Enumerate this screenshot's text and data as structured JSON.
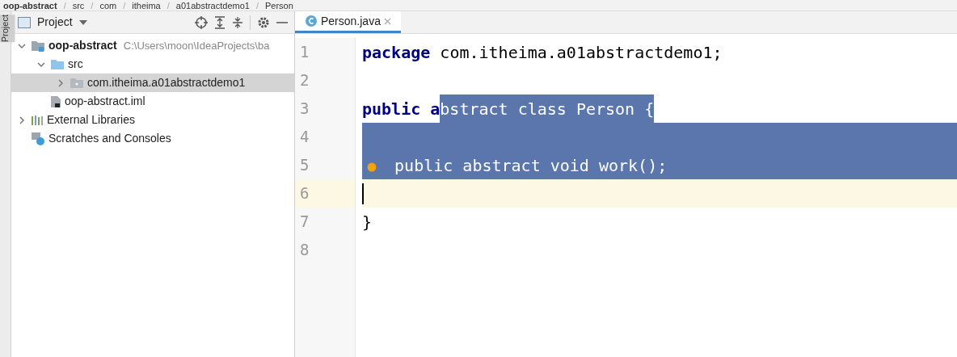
{
  "breadcrumb": [
    {
      "text": "oop-abstract",
      "kind": "item"
    },
    {
      "text": "/",
      "kind": "separator"
    },
    {
      "text": "src",
      "kind": "item"
    },
    {
      "text": "/",
      "kind": "separator"
    },
    {
      "text": "com",
      "kind": "item"
    },
    {
      "text": "/",
      "kind": "separator"
    },
    {
      "text": "itheima",
      "kind": "item"
    },
    {
      "text": "/",
      "kind": "separator"
    },
    {
      "text": "a01abstractdemo1",
      "kind": "item"
    },
    {
      "text": "/",
      "kind": "separator"
    },
    {
      "text": "Person",
      "kind": "item"
    }
  ],
  "tool_strip": {
    "label": "Project"
  },
  "project_panel": {
    "title": "Project",
    "tree": [
      {
        "label": "oop-abstract",
        "kind": "module",
        "path": "C:\\Users\\moon\\IdeaProjects\\ba",
        "expanded": true,
        "selected": false,
        "children": [
          {
            "label": "src",
            "kind": "folder",
            "expanded": true,
            "selected": false,
            "children": [
              {
                "label": "com.itheima.a01abstractdemo1",
                "kind": "package",
                "expanded": false,
                "selected": true
              }
            ]
          },
          {
            "label": "oop-abstract.iml",
            "kind": "file",
            "selected": false
          }
        ]
      },
      {
        "label": "External Libraries",
        "kind": "libraries",
        "expanded": false,
        "selected": false
      },
      {
        "label": "Scratches and Consoles",
        "kind": "scratches",
        "selected": false
      }
    ]
  },
  "editor": {
    "tabs": [
      {
        "label": "Person.java",
        "selected": true
      }
    ],
    "lines": [
      {
        "number": "1",
        "current": false,
        "segments": [
          {
            "text": "package",
            "kind": "keyword",
            "selected": false
          },
          {
            "text": " com.itheima.a01abstractdemo1;",
            "kind": "plain",
            "selected": false
          }
        ]
      },
      {
        "number": "2",
        "current": false
      },
      {
        "number": "3",
        "current": false,
        "segments": [
          {
            "text": "public a",
            "kind": "keyword",
            "selected": false
          },
          {
            "text": "bstract class Person {",
            "kind": "plain",
            "selected": true
          }
        ]
      },
      {
        "number": "4",
        "current": false,
        "full_selected": true
      },
      {
        "number": "5",
        "current": false,
        "full_selected": true,
        "marker": true,
        "segments": [
          {
            "text": "  public abstract void work();",
            "kind": "plain",
            "selected": true
          }
        ]
      },
      {
        "number": "6",
        "current": true,
        "caret": true
      },
      {
        "number": "7",
        "current": false,
        "segments": [
          {
            "text": "}",
            "kind": "plain",
            "selected": false
          }
        ]
      },
      {
        "number": "8",
        "current": false
      }
    ]
  }
}
